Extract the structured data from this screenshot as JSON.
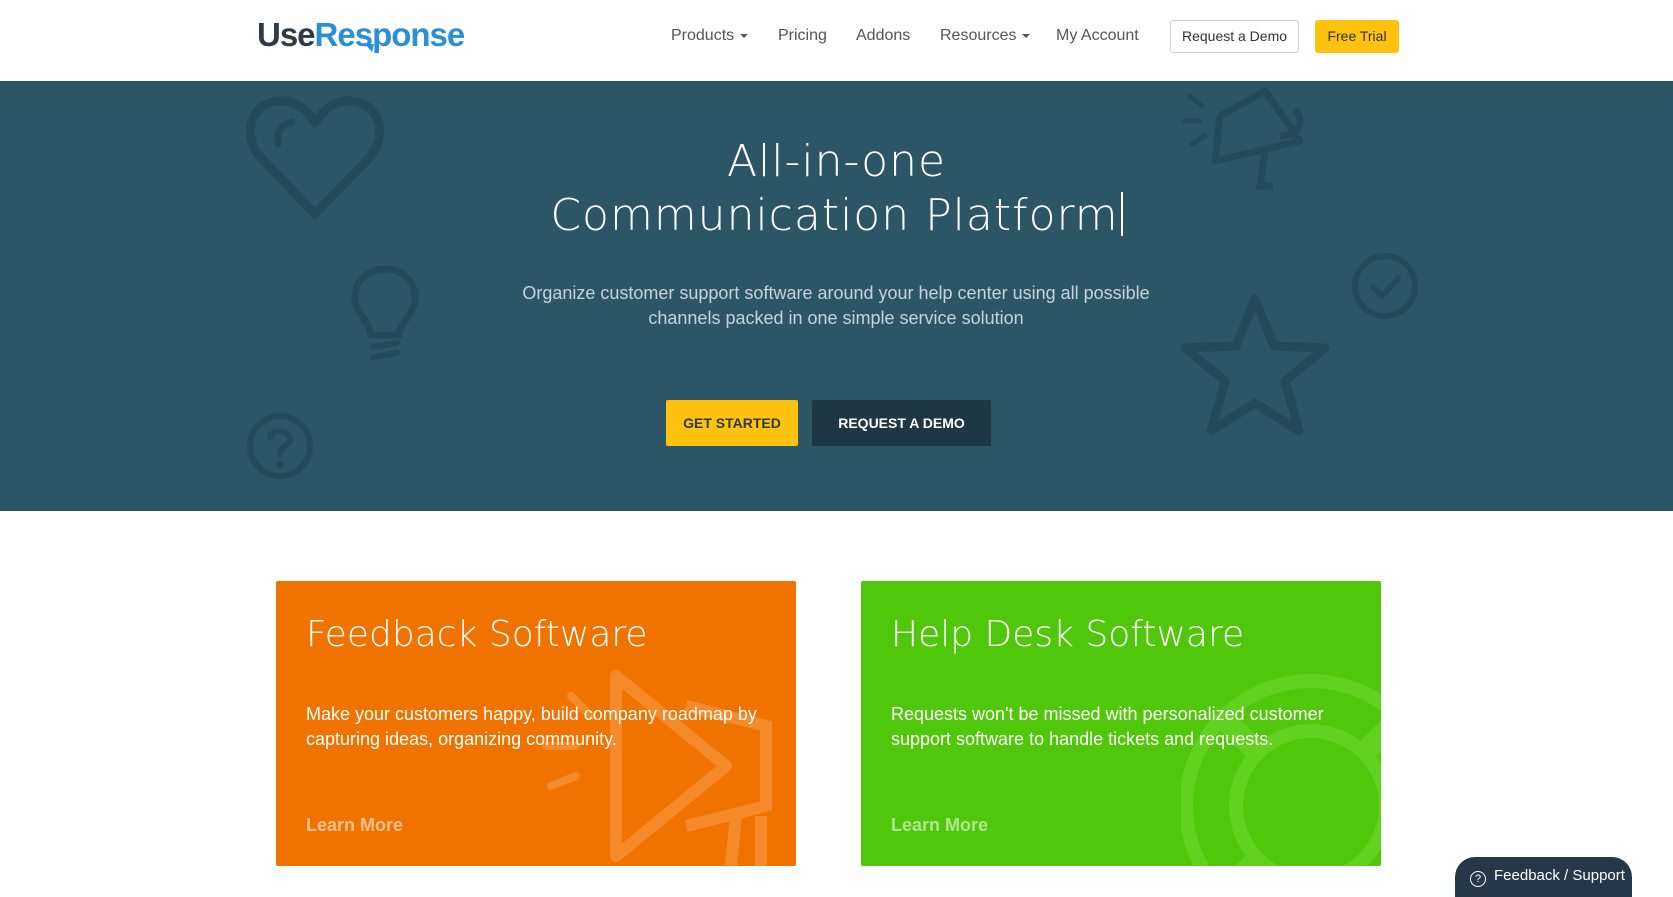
{
  "header": {
    "logo": {
      "part1": "Use",
      "part2": "Response"
    },
    "nav": [
      {
        "label": "Products",
        "has_dropdown": true
      },
      {
        "label": "Pricing",
        "has_dropdown": false
      },
      {
        "label": "Addons",
        "has_dropdown": false
      },
      {
        "label": "Resources",
        "has_dropdown": true
      },
      {
        "label": "My Account",
        "has_dropdown": false
      }
    ],
    "request_demo_label": "Request a Demo",
    "free_trial_label": "Free Trial"
  },
  "hero": {
    "title_line1": "All-in-one",
    "title_line2": "Communication Platform",
    "subtitle_line1": "Organize customer support software around your help center using all possible",
    "subtitle_line2": "channels packed in one simple service solution",
    "get_started_label": "GET STARTED",
    "request_demo_label": "REQUEST A DEMO",
    "background_color": "#2c5566",
    "icons": [
      "heart-icon",
      "lightbulb-icon",
      "question-icon",
      "megaphone-icon",
      "checkmark-icon",
      "star-icon"
    ]
  },
  "cards": [
    {
      "title": "Feedback Software",
      "text": "Make your customers happy, build company roadmap by capturing ideas, organizing community.",
      "link": "Learn More",
      "color": "#f07300",
      "icon": "megaphone-icon"
    },
    {
      "title": "Help Desk Software",
      "text": "Requests won't be missed with personalized customer support software to handle tickets and requests.",
      "link": "Learn More",
      "color": "#51c70b",
      "icon": "lifebuoy-icon"
    }
  ],
  "support_widget": {
    "label": "Feedback / Support",
    "icon": "question-circle-icon"
  },
  "colors": {
    "accent": "#ffc20e",
    "dark_button": "#1f3644",
    "brand_blue": "#2a8fd6"
  }
}
